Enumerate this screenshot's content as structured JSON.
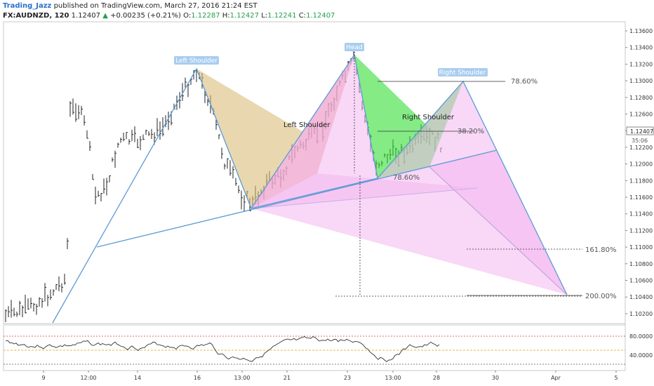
{
  "header": {
    "author": "Trading_Jazz",
    "published_text": "published on TradingView.com, March 27, 2016 21:24 EST",
    "symbol": "FX:AUDNZD, 120",
    "last": "1.12407",
    "change_arrow": "▲",
    "change": "+0.00235 (+0.21%)",
    "o_label": "O:",
    "o_value": "1.12287",
    "h_label": "H:",
    "h_value": "1.12427",
    "l_label": "L:",
    "l_value": "1.12241",
    "c_label": "C:",
    "c_value": "1.12407"
  },
  "price_axis": {
    "ticks": [
      "1.13600",
      "1.13400",
      "1.13200",
      "1.13000",
      "1.12800",
      "1.12600",
      "1.12400",
      "1.12200",
      "1.12000",
      "1.11800",
      "1.11600",
      "1.11400",
      "1.11200",
      "1.11000",
      "1.10800",
      "1.10600",
      "1.10400",
      "1.10200"
    ],
    "current_price": "1.12407",
    "countdown": "35:06"
  },
  "rsi_axis": {
    "ticks": [
      "80.0000",
      "40.0000"
    ]
  },
  "time_axis": {
    "ticks": [
      "9",
      "12:00",
      "14",
      "16",
      "13:00",
      "21",
      "23",
      "13:00",
      "28",
      "30",
      "Apr",
      "5"
    ]
  },
  "annotations": {
    "left_shoulder_tag": "Left Shoulder",
    "head_tag": "Head",
    "right_shoulder_tag": "Right Shoulder",
    "left_shoulder_text": "Left Shoulder",
    "right_shoulder_text": "Right Shoulder",
    "fib_78_top": "78.60%",
    "fib_38": "38.20%",
    "fib_78_mid": "78.60%",
    "fib_161": "161.80%",
    "fib_200": "200.00%"
  },
  "colors": {
    "up_color": "#22a04a",
    "author_color": "#2a6fc9",
    "pattern_line": "#5b9bd5",
    "abcd_orange": "#d9bc7a",
    "abcd_green": "#33dd33",
    "abcd_pink": "#f4b6f0",
    "abcd_red": "#e88a8a",
    "rsi_line": "#333333",
    "rsi_upper": "#d33",
    "rsi_mid": "#d4a017"
  }
}
